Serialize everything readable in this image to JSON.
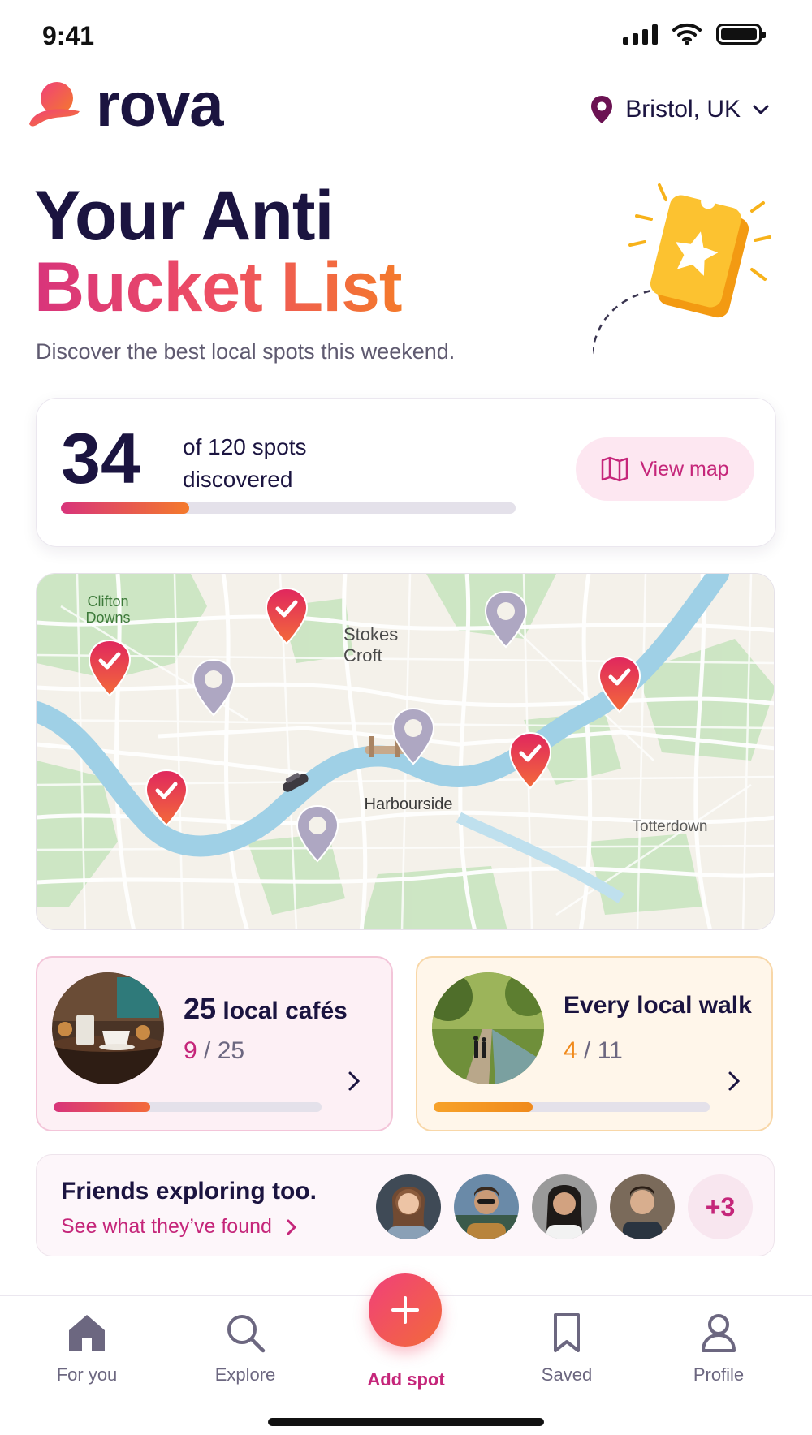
{
  "status_bar": {
    "time": "9:41"
  },
  "header": {
    "brand": "rova",
    "location": "Bristol, UK"
  },
  "hero": {
    "title_line1": "Your Anti",
    "title_line2": "Bucket List",
    "subtitle": "Discover the best local spots this weekend."
  },
  "progress": {
    "count": "34",
    "caption_line1": "of 120 spots",
    "caption_line2": "discovered",
    "fraction": 0.283,
    "view_map_label": "View map"
  },
  "map": {
    "labels": {
      "clifton_line1": "Clifton",
      "clifton_line2": "Downs",
      "stokes_line1": "Stokes",
      "stokes_line2": "Croft",
      "harbourside": "Harbourside",
      "totterdown": "Totterdown"
    },
    "pins": [
      {
        "id": "pin-1",
        "status": "visited"
      },
      {
        "id": "pin-2",
        "status": "visited"
      },
      {
        "id": "pin-3",
        "status": "unvisited"
      },
      {
        "id": "pin-4",
        "status": "unvisited"
      },
      {
        "id": "pin-5",
        "status": "unvisited"
      },
      {
        "id": "pin-6",
        "status": "visited"
      },
      {
        "id": "pin-7",
        "status": "visited"
      },
      {
        "id": "pin-8",
        "status": "visited"
      },
      {
        "id": "pin-9",
        "status": "unvisited"
      }
    ]
  },
  "categories": [
    {
      "count": "25",
      "title": "local cafés",
      "done": "9",
      "total": "25",
      "progress": 0.36,
      "accent": "#c5267a"
    },
    {
      "title": "Every local walk",
      "done": "4",
      "total": "11",
      "progress": 0.36,
      "accent": "#f08a1c"
    }
  ],
  "friends": {
    "title": "Friends exploring too.",
    "link": "See what they’ve found",
    "more": "+3"
  },
  "nav": {
    "items": [
      "For you",
      "Explore",
      "Add spot",
      "Saved",
      "Profile"
    ],
    "active": "Add spot"
  },
  "colors": {
    "brand_dark": "#1b1440",
    "accent_pink": "#c5267a",
    "accent_orange": "#f47a2b"
  }
}
